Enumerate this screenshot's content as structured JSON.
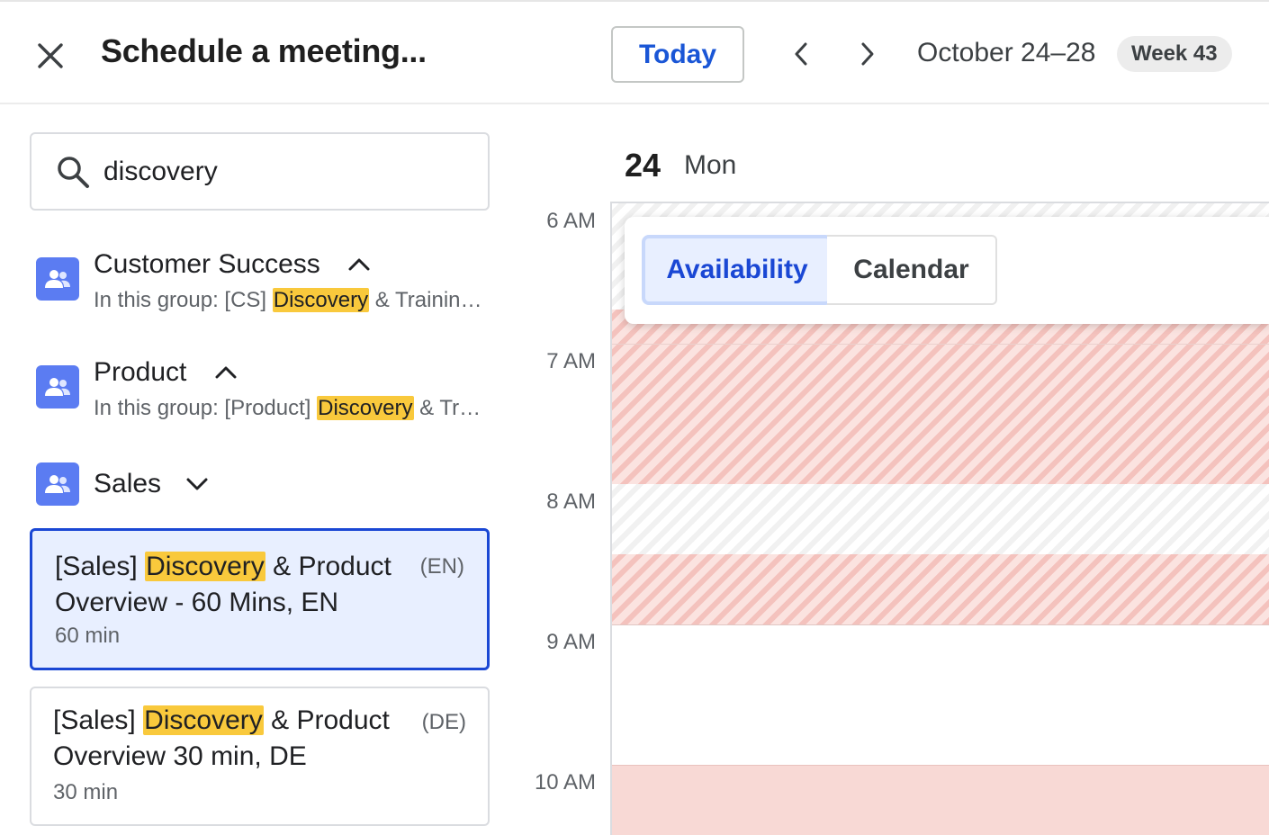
{
  "header": {
    "title": "Schedule a meeting...",
    "today_label": "Today",
    "date_range": "October 24–28",
    "week_badge": "Week 43",
    "icons": {
      "close": "close-icon",
      "prev": "chevron-left-icon",
      "next": "chevron-right-icon"
    }
  },
  "search": {
    "value": "discovery",
    "icon": "search-icon"
  },
  "groups": [
    {
      "name": "Customer Success",
      "expanded": true,
      "desc_prefix": "In this group: [CS] ",
      "desc_highlight": "Discovery",
      "desc_suffix": " & Trainin…",
      "icon": "people-icon"
    },
    {
      "name": "Product",
      "expanded": true,
      "desc_prefix": "In this group: [Product] ",
      "desc_highlight": "Discovery",
      "desc_suffix": " & Tr…",
      "icon": "people-icon"
    },
    {
      "name": "Sales",
      "expanded": false,
      "icon": "people-icon"
    }
  ],
  "event_types": [
    {
      "prefix": "[Sales] ",
      "highlight": "Discovery",
      "suffix": " & Product Overview - 60 Mins, EN",
      "lang": "(EN)",
      "duration": "60 min",
      "selected": true
    },
    {
      "prefix": "[Sales] ",
      "highlight": "Discovery",
      "suffix": " & Product Overview 30 min, DE",
      "lang": "(DE)",
      "duration": "30 min",
      "selected": false
    }
  ],
  "calendar": {
    "day_number": "24",
    "day_name": "Mon",
    "times": [
      "6 AM",
      "7 AM",
      "8 AM",
      "9 AM",
      "10 AM"
    ],
    "view_toggle": {
      "availability": "Availability",
      "calendar": "Calendar",
      "active": "availability"
    }
  },
  "colors": {
    "accent": "#1a47d4",
    "highlight": "#f9c93c",
    "group_icon": "#5b7cf2",
    "unavailable": "#f8d9d5"
  }
}
